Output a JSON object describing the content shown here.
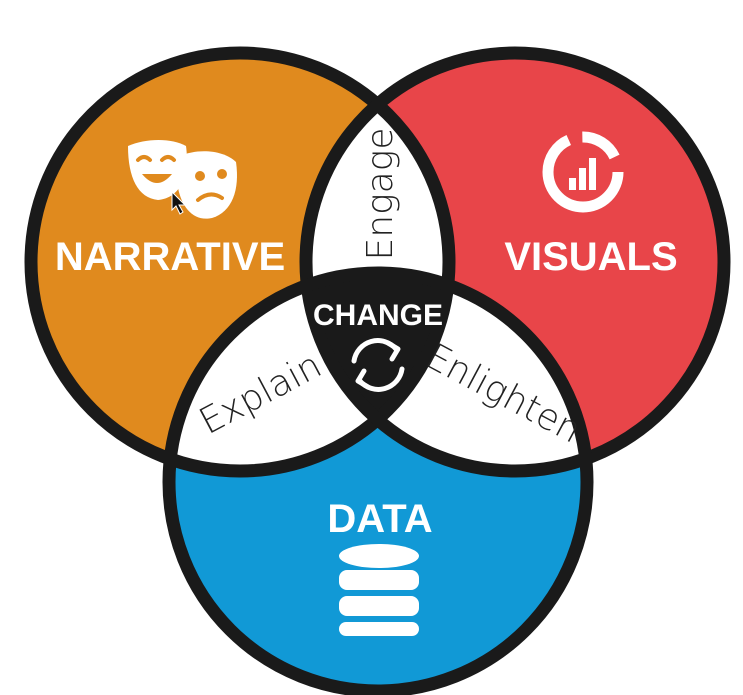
{
  "diagram": {
    "circles": [
      {
        "id": "narrative",
        "label": "NARRATIVE",
        "color": "#E08A1E",
        "icon": "theater-masks-icon"
      },
      {
        "id": "visuals",
        "label": "VISUALS",
        "color": "#E84549",
        "icon": "donut-bar-chart-icon"
      },
      {
        "id": "data",
        "label": "DATA",
        "color": "#1199D6",
        "icon": "database-icon"
      }
    ],
    "overlaps": {
      "narrative_visuals": "Engage",
      "narrative_data": "Explain",
      "visuals_data": "Enlighten"
    },
    "center": {
      "label": "CHANGE",
      "icon": "refresh-cycle-icon",
      "color": "#1a1a1a"
    },
    "outline_color": "#1a1a1a"
  }
}
